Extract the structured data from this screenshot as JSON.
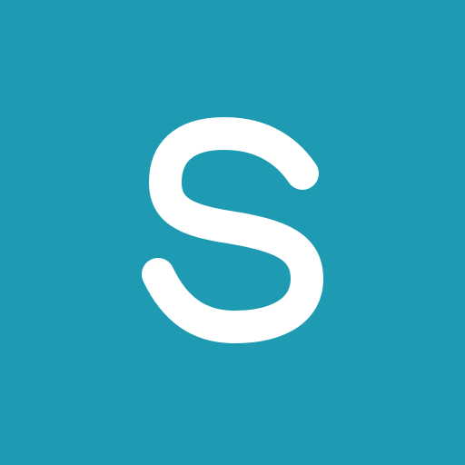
{
  "icon": {
    "name": "s-logo-icon",
    "glyph": "S",
    "background_color": "#1E9AB3",
    "glyph_color": "#FFFFFF"
  }
}
